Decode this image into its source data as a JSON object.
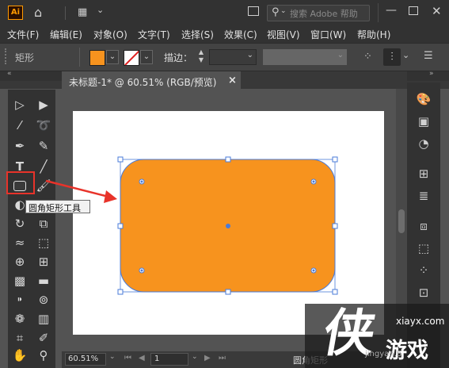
{
  "app": {
    "logo": "Ai"
  },
  "titlebar": {
    "search_placeholder": "搜索 Adobe 帮助"
  },
  "menu": [
    "文件(F)",
    "编辑(E)",
    "对象(O)",
    "文字(T)",
    "选择(S)",
    "效果(C)",
    "视图(V)",
    "窗口(W)",
    "帮助(H)"
  ],
  "control": {
    "label": "矩形",
    "stroke_label": "描边：",
    "fill_color": "#f7931e"
  },
  "document": {
    "tab_title": "未标题-1* @ 60.51% (RGB/预览)"
  },
  "tooltip": {
    "text": "圆角矩形工具"
  },
  "status": {
    "zoom": "60.51%",
    "page": "1",
    "selection": "圆角矩形"
  },
  "watermark": {
    "url": "xiayx.com",
    "site_cn": "游戏",
    "sub": "jingyan.b"
  },
  "colors": {
    "accent": "#f7931e",
    "selection": "#4a7bd8",
    "highlight": "#e8332a"
  }
}
